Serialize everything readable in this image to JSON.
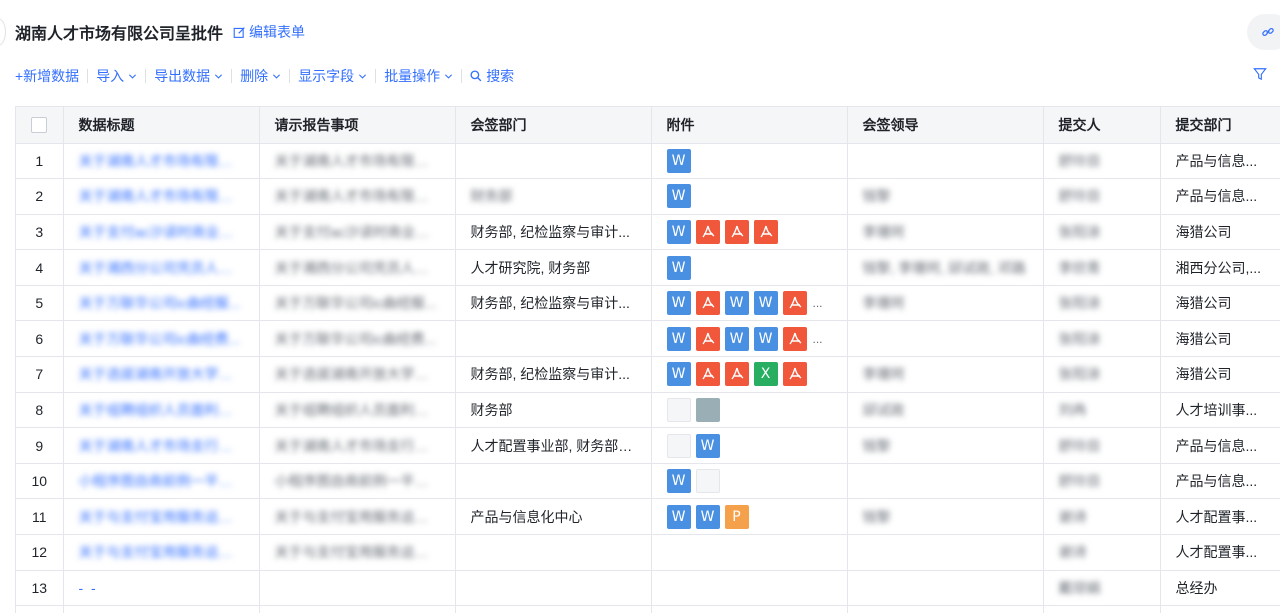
{
  "header": {
    "title": "湖南人才市场有限公司呈批件",
    "edit_form": "编辑表单"
  },
  "toolbar": {
    "items": [
      {
        "label": "+新增数据",
        "dropdown": false
      },
      {
        "label": "导入",
        "dropdown": true
      },
      {
        "label": "导出数据",
        "dropdown": true
      },
      {
        "label": "删除",
        "dropdown": true
      },
      {
        "label": "显示字段",
        "dropdown": true
      },
      {
        "label": "批量操作",
        "dropdown": true
      },
      {
        "label": "搜索",
        "dropdown": false
      }
    ]
  },
  "table": {
    "columns": [
      "",
      "数据标题",
      "请示报告事项",
      "会签部门",
      "附件",
      "会签领导",
      "提交人",
      "提交部门"
    ],
    "rows": [
      {
        "n": "1",
        "title": "关于湖南人才市场有限公...",
        "matter": "关于湖南人才市场有限公...",
        "dept": "",
        "files": [
          "word"
        ],
        "leader": "",
        "submitter": "舒玲目",
        "sdept": "产品与信息..."
      },
      {
        "n": "2",
        "title": "关于湖南人才市场有限公...",
        "matter": "关于湖南人才市场有限公...",
        "dept": "财务部",
        "dept_blur": true,
        "files": [
          "word"
        ],
        "leader": "钱黎",
        "submitter": "舒玲目",
        "sdept": "产品与信息..."
      },
      {
        "n": "3",
        "title": "关于支付ac沙读时商业固...",
        "matter": "关于支付ac沙读时商业固...",
        "dept": "财务部, 纪检监察与审计...",
        "files": [
          "word",
          "pdf",
          "pdf",
          "pdf"
        ],
        "leader": "李珊珂",
        "submitter": "张阳涂",
        "sdept": "海猎公司"
      },
      {
        "n": "4",
        "title": "关于湘西分公司凭员人递...",
        "matter": "关于湘西分公司凭员人递...",
        "dept": "人才研究院, 财务部",
        "files": [
          "word"
        ],
        "leader": "钱黎, 李珊珂, 邱试政, 邓路",
        "submitter": "李欣青",
        "sdept": "湘西分公司,..."
      },
      {
        "n": "5",
        "title": "关于万联华公司ic曲经服...",
        "matter": "关于万联华公司ic曲经服...",
        "dept": "财务部, 纪检监察与审计...",
        "files": [
          "word",
          "pdf",
          "word",
          "word",
          "pdf"
        ],
        "more": "...",
        "leader": "李珊珂",
        "submitter": "张阳涂",
        "sdept": "海猎公司"
      },
      {
        "n": "6",
        "title": "关于万联华公司ic曲经费...",
        "matter": "关于万联华公司ic曲经费...",
        "dept": "",
        "files": [
          "word",
          "pdf",
          "word",
          "word",
          "pdf"
        ],
        "more": "...",
        "leader": "",
        "submitter": "张阳涂",
        "sdept": "海猎公司"
      },
      {
        "n": "7",
        "title": "关于选拔湖南开放大学所...",
        "matter": "关于选拔湖南开放大学所...",
        "dept": "财务部, 纪检监察与审计...",
        "files": [
          "word",
          "pdf",
          "pdf",
          "xls",
          "pdf"
        ],
        "leader": "李珊珂",
        "submitter": "张阳涂",
        "sdept": "海猎公司"
      },
      {
        "n": "8",
        "title": "关于组聘组织人员面利订...",
        "matter": "关于组聘组织人员面利订...",
        "dept": "财务部",
        "files": [
          "thumb",
          "img"
        ],
        "leader": "邱试政",
        "submitter": "刘冉",
        "sdept": "人才培训事..."
      },
      {
        "n": "9",
        "title": "关于湖南人才市场支行住...",
        "matter": "关于湖南人才市场支行住...",
        "dept": "人才配置事业部, 财务部, ...",
        "files": [
          "thumb",
          "word"
        ],
        "leader": "钱黎",
        "submitter": "舒玲目",
        "sdept": "产品与信息..."
      },
      {
        "n": "10",
        "title": "小程序图自商前例一平台...",
        "matter": "小程序图自商前例一平台...",
        "dept": "",
        "files": [
          "word",
          "thumb"
        ],
        "leader": "",
        "submitter": "舒玲目",
        "sdept": "产品与信息..."
      },
      {
        "n": "11",
        "title": "关于与支付宝用服务运题...",
        "matter": "关于与支付宝用服务运题...",
        "dept": "产品与信息化中心",
        "files": [
          "word",
          "word",
          "ppt"
        ],
        "leader": "钱黎",
        "submitter": "谢诗",
        "sdept": "人才配置事..."
      },
      {
        "n": "12",
        "title": "关于与支付宝用服务运题...",
        "matter": "关于与支付宝用服务运题...",
        "dept": "",
        "files": [],
        "leader": "",
        "submitter": "谢诗",
        "sdept": "人才配置事..."
      },
      {
        "n": "13",
        "title": "- -",
        "title_dash": true,
        "matter": "",
        "dept": "",
        "files": [],
        "leader": "",
        "submitter": "戴琼娟",
        "sdept": "总经办"
      },
      {
        "n": "",
        "title": "",
        "matter": "",
        "dept": "",
        "files": [],
        "leader": "",
        "submitter": "",
        "sdept": ""
      }
    ]
  },
  "colors": {
    "accent": "#3370ff",
    "word": "#4a90e2",
    "pdf": "#f0573b",
    "xls": "#27ae60",
    "ppt": "#f5a04a"
  }
}
